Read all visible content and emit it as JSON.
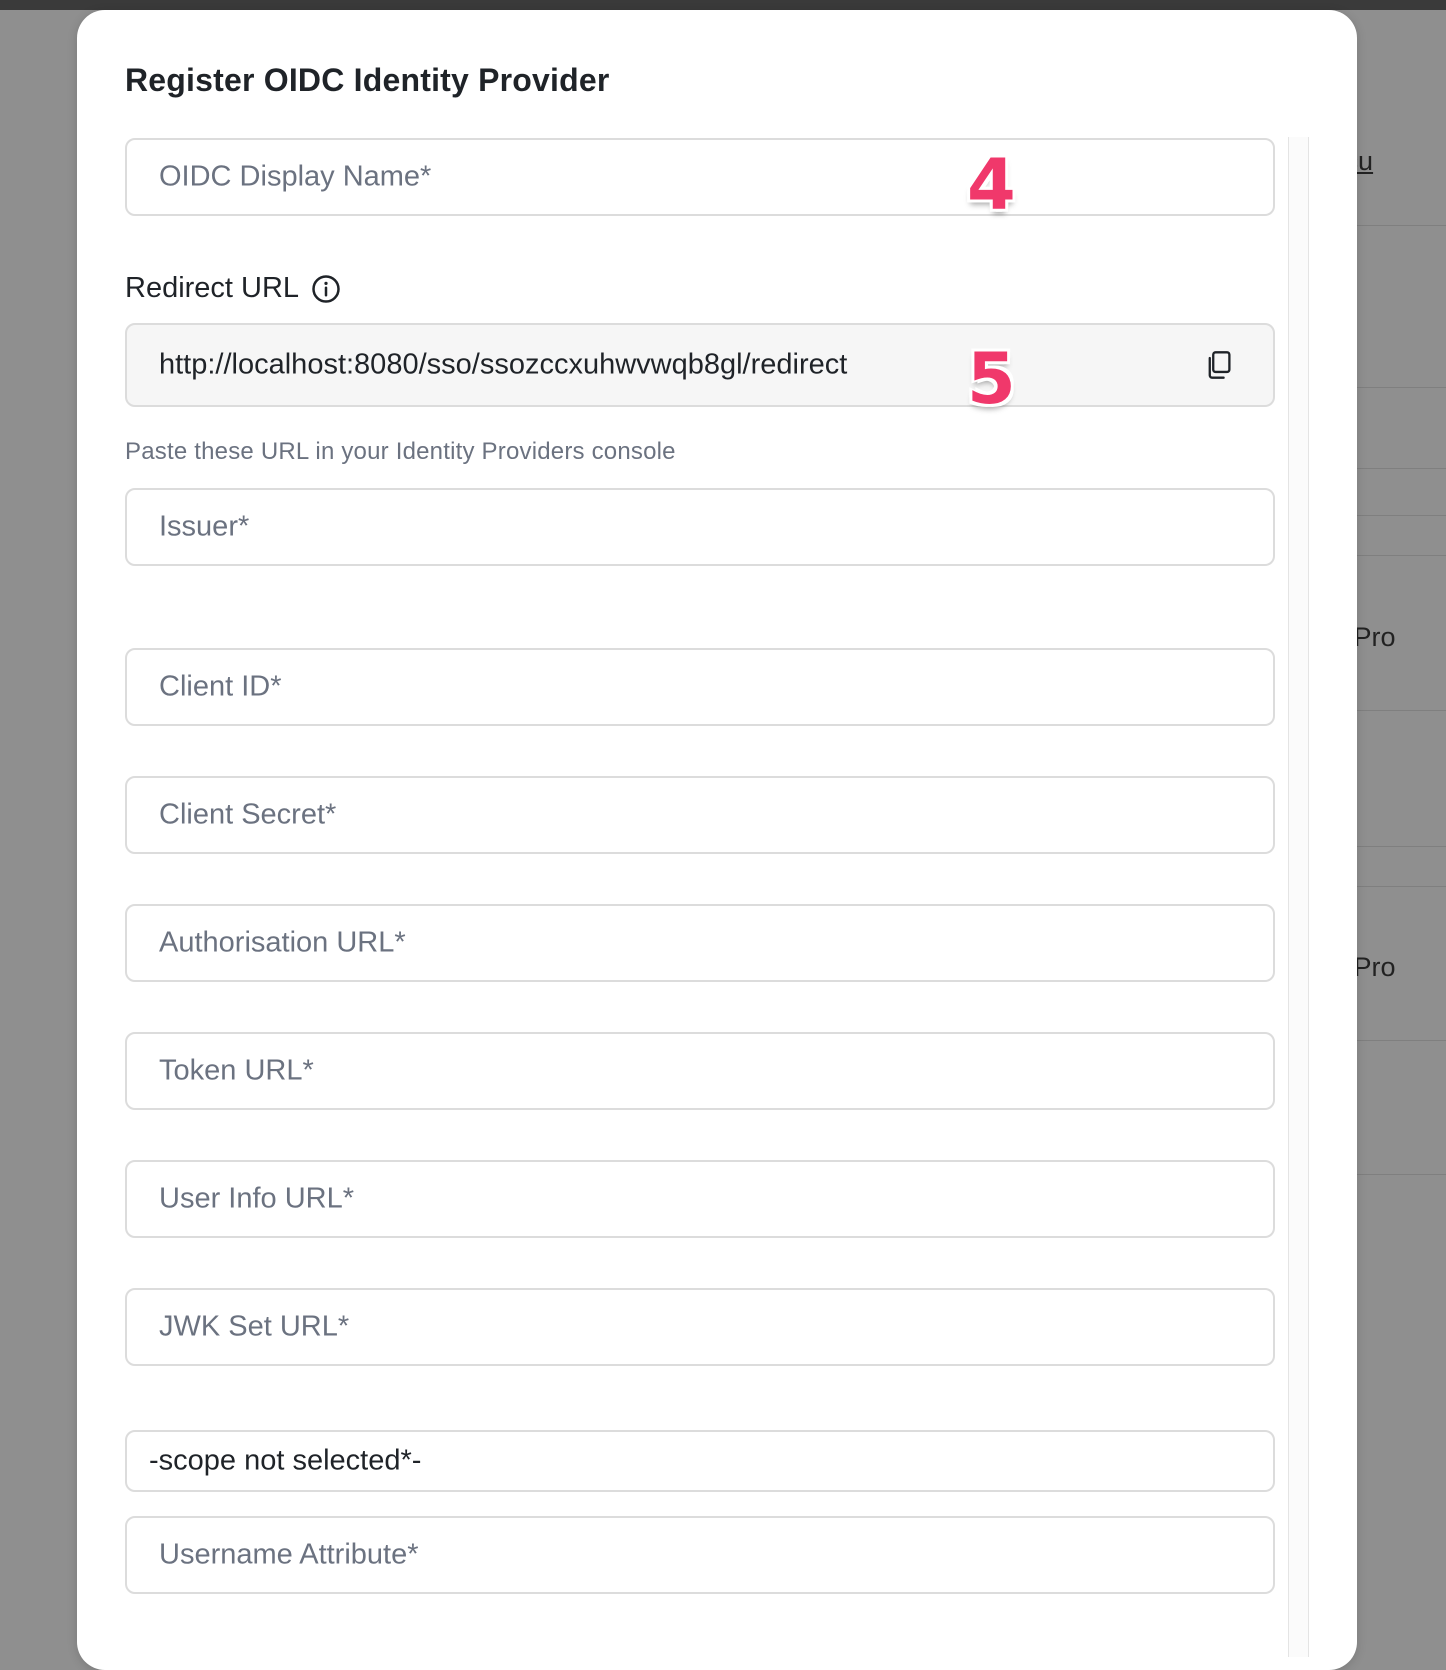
{
  "modal": {
    "title": "Register OIDC Identity Provider"
  },
  "fields": {
    "display_name": {
      "placeholder": "OIDC Display Name*"
    },
    "redirect": {
      "label": "Redirect URL",
      "value": "http://localhost:8080/sso/ssozccxuhwvwqb8gl/redirect",
      "helper": "Paste these URL in your Identity Providers console"
    },
    "issuer": {
      "placeholder": "Issuer*"
    },
    "client_id": {
      "placeholder": "Client ID*"
    },
    "client_secret": {
      "placeholder": "Client Secret*"
    },
    "authorisation_url": {
      "placeholder": "Authorisation URL*"
    },
    "token_url": {
      "placeholder": "Token URL*"
    },
    "user_info_url": {
      "placeholder": "User Info URL*"
    },
    "jwk_set_url": {
      "placeholder": "JWK Set URL*"
    },
    "scope": {
      "value": "-scope not selected*-"
    },
    "username_attribute": {
      "placeholder": "Username Attribute*"
    }
  },
  "annotations": {
    "step4": "4",
    "step5": "5"
  },
  "background_page": {
    "link_fragment": "o docu",
    "item1": "New Pro",
    "item2": "New Pro"
  },
  "icons": {
    "info": "info-icon",
    "copy": "copy-icon"
  },
  "colors": {
    "accent_badge": "#f0386b",
    "overlay": "#8f8f8f"
  }
}
